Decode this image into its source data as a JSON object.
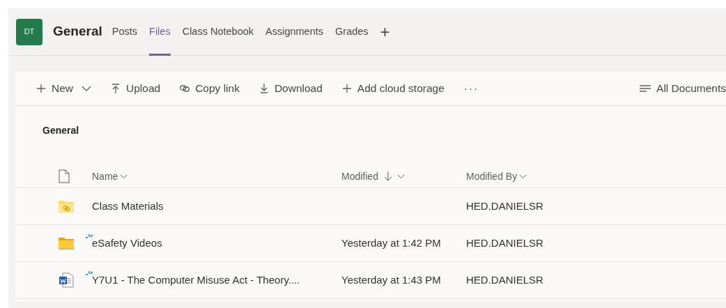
{
  "channel": {
    "avatar": "DT",
    "name": "General"
  },
  "tabs": [
    {
      "label": "Posts",
      "selected": false
    },
    {
      "label": "Files",
      "selected": true
    },
    {
      "label": "Class Notebook",
      "selected": false
    },
    {
      "label": "Assignments",
      "selected": false
    },
    {
      "label": "Grades",
      "selected": false
    }
  ],
  "add_tab": "+",
  "toolbar": [
    {
      "kind": "new",
      "label": "New"
    },
    {
      "kind": "upload",
      "label": "Upload"
    },
    {
      "kind": "link",
      "label": "Copy link"
    },
    {
      "kind": "download",
      "label": "Download"
    },
    {
      "kind": "add",
      "label": "Add cloud storage"
    },
    {
      "kind": "more",
      "label": "···"
    }
  ],
  "view": {
    "label": "All Documents"
  },
  "folder_title": "General",
  "columns": [
    "Name",
    "Modified",
    "Modified By"
  ],
  "rows": [
    {
      "kind": "shared-folder",
      "name": "Class Materials",
      "is_new": false,
      "modified": "",
      "modified_by": "HED.DANIELSR"
    },
    {
      "kind": "folder",
      "name": "eSafety Videos",
      "is_new": true,
      "modified": "Yesterday at 1:42 PM",
      "modified_by": "HED.DANIELSR"
    },
    {
      "kind": "word",
      "name": "Y7U1 - The Computer Misuse Act - Theory....",
      "is_new": true,
      "modified": "Yesterday at 1:43 PM",
      "modified_by": "HED.DANIELSR"
    }
  ]
}
